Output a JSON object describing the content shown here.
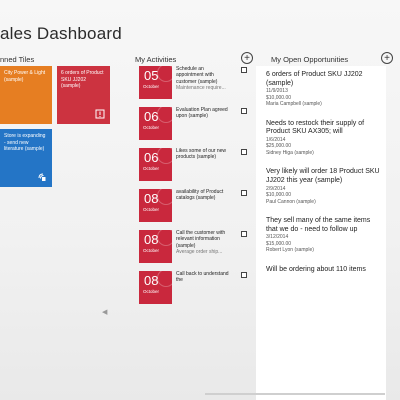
{
  "page_title": "ales Dashboard",
  "pinned_tiles": {
    "label": "nned Tiles",
    "tiles": [
      {
        "text": "City Power & Light (sample)",
        "color": "#e67e22"
      },
      {
        "text": "6 orders of Product SKU JJ202 (sample)",
        "color": "#cc3340"
      },
      {
        "text": "Store is expanding - send new literature (sample)",
        "color": "#2475c6"
      }
    ]
  },
  "activities": {
    "label": "My Activities",
    "add_symbol": "+",
    "items": [
      {
        "day": "05",
        "month": "October",
        "text": "Schedule an appointment with customer (sample)",
        "sub": "Maintenance require..."
      },
      {
        "day": "06",
        "month": "October",
        "text": "Evaluation Plan agreed upon (sample)",
        "sub": ""
      },
      {
        "day": "06",
        "month": "October",
        "text": "Likes some of our new products (sample)",
        "sub": ""
      },
      {
        "day": "08",
        "month": "October",
        "text": "availability of Product catalogs (sample)",
        "sub": ""
      },
      {
        "day": "08",
        "month": "October",
        "text": "Call the customer with relevant information (sample)",
        "sub": "Average order ship..."
      },
      {
        "day": "08",
        "month": "October",
        "text": "Call back to understand the",
        "sub": ""
      }
    ]
  },
  "opportunities": {
    "label": "My Open Opportunities",
    "add_symbol": "+",
    "items": [
      {
        "title": "6 orders of Product SKU JJ202 (sample)",
        "date": "11/9/2013",
        "amount": "$10,000.00",
        "owner": "Maria Campbell (sample)"
      },
      {
        "title": "Needs to restock their supply of Product SKU AX305; will",
        "date": "1/6/2014",
        "amount": "$25,000.00",
        "owner": "Sidney Higa (sample)"
      },
      {
        "title": "Very likely will order 18 Product SKU JJ202 this year (sample)",
        "date": "2/9/2014",
        "amount": "$10,000.00",
        "owner": "Paul Cannon (sample)"
      },
      {
        "title": "They sell many of the same items that we do - need to follow up",
        "date": "3/12/2014",
        "amount": "$15,000.00",
        "owner": "Robert Lyon (sample)"
      },
      {
        "title": "Will be ordering about 110 items",
        "date": "",
        "amount": "",
        "owner": ""
      }
    ]
  }
}
